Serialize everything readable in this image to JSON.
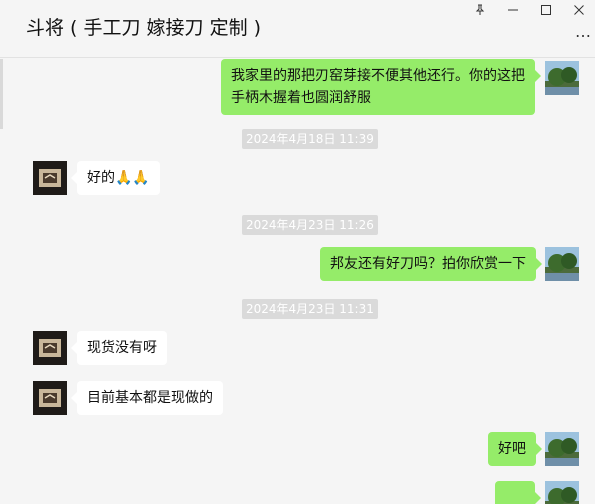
{
  "window": {
    "title": "斗将 ( 手工刀  嫁接刀 定制 )",
    "pin_icon": "pin-icon",
    "minimize_icon": "minimize-icon",
    "maximize_icon": "maximize-icon",
    "close_icon": "close-icon",
    "more_icon": "more-icon"
  },
  "messages": [
    {
      "from": "self",
      "lines": [
        "我家里的那把刃窑芽接不便其他还行。你的这把",
        "手柄木握着也圆润舒服"
      ]
    },
    {
      "type": "time",
      "text": "2024年4月18日 11:39"
    },
    {
      "from": "other",
      "text": "好的",
      "emoji": "🙏🙏"
    },
    {
      "type": "time",
      "text": "2024年4月23日 11:26"
    },
    {
      "from": "self",
      "text": "邦友还有好刀吗？拍你欣赏一下"
    },
    {
      "type": "time",
      "text": "2024年4月23日 11:31"
    },
    {
      "from": "other",
      "text": "现货没有呀"
    },
    {
      "from": "other",
      "text": "目前基本都是现做的"
    },
    {
      "from": "self",
      "text": "好吧"
    }
  ],
  "colors": {
    "self_bubble": "#95ec69",
    "other_bubble": "#ffffff",
    "background": "#f5f5f5",
    "timestamp_bg": "#dadada"
  }
}
